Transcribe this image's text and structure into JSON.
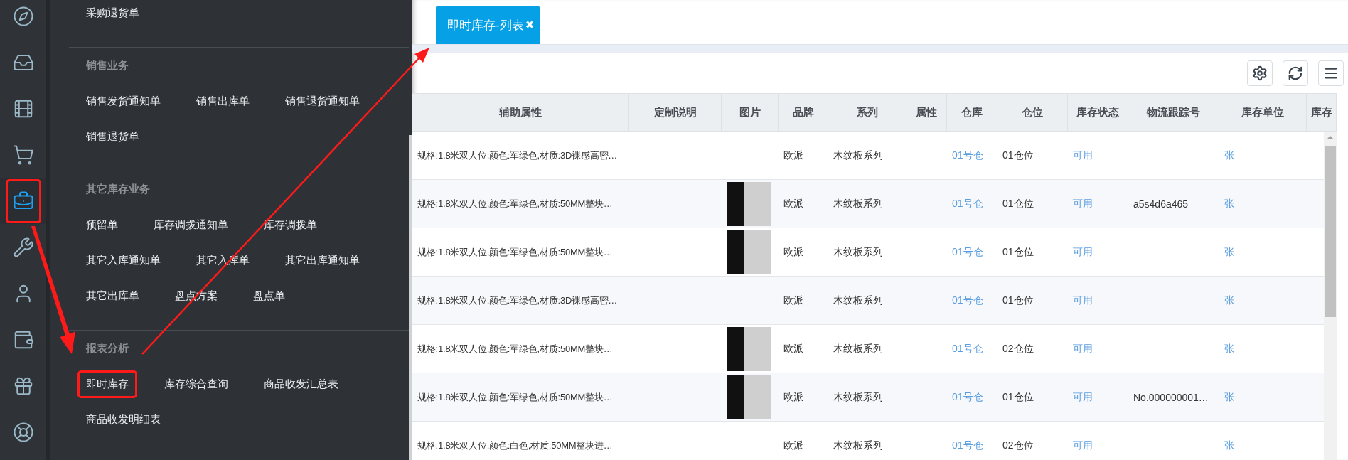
{
  "rail": [
    {
      "selected": false,
      "highlighted": false
    },
    {
      "selected": false,
      "highlighted": false
    },
    {
      "selected": false,
      "highlighted": false
    },
    {
      "selected": false,
      "highlighted": false
    },
    {
      "selected": true,
      "highlighted": true
    },
    {
      "selected": false,
      "highlighted": false
    },
    {
      "selected": false,
      "highlighted": false
    },
    {
      "selected": false,
      "highlighted": false
    },
    {
      "selected": false,
      "highlighted": false
    },
    {
      "selected": false,
      "highlighted": false
    }
  ],
  "menu": {
    "sections": [
      {
        "items": [
          {
            "label": "采购退货单",
            "highlighted": false
          }
        ]
      },
      {
        "header": "销售业务",
        "items": [
          {
            "label": "销售发货通知单",
            "highlighted": false
          },
          {
            "label": "销售出库单",
            "highlighted": false
          },
          {
            "label": "销售退货通知单",
            "highlighted": false
          },
          {
            "label": "销售退货单",
            "highlighted": false
          }
        ]
      },
      {
        "header": "其它库存业务",
        "items": [
          {
            "label": "预留单",
            "highlighted": false
          },
          {
            "label": "库存调拨通知单",
            "highlighted": false
          },
          {
            "label": "库存调拨单",
            "highlighted": false
          },
          {
            "label": "其它入库通知单",
            "highlighted": false
          },
          {
            "label": "其它入库单",
            "highlighted": false
          },
          {
            "label": "其它出库通知单",
            "highlighted": false
          },
          {
            "label": "其它出库单",
            "highlighted": false
          },
          {
            "label": "盘点方案",
            "highlighted": false
          },
          {
            "label": "盘点单",
            "highlighted": false
          }
        ]
      },
      {
        "header": "报表分析",
        "items": [
          {
            "label": "即时库存",
            "highlighted": true
          },
          {
            "label": "库存综合查询",
            "highlighted": false
          },
          {
            "label": "商品收发汇总表",
            "highlighted": false
          },
          {
            "label": "商品收发明细表",
            "highlighted": false
          }
        ]
      }
    ]
  },
  "tabs": [
    {
      "label": "即时库存-列表",
      "close": "✖",
      "selected": true
    }
  ],
  "table": {
    "columns": [
      "辅助属性",
      "定制说明",
      "图片",
      "品牌",
      "系列",
      "属性",
      "仓库",
      "仓位",
      "库存状态",
      "物流跟踪号",
      "库存单位",
      "库存"
    ],
    "rows": [
      {
        "attr": "规格:1.8米双人位,颜色:军绿色,材质:3D裸感高密…",
        "photo": false,
        "brand": "欧派",
        "series": "木纹板系列",
        "warehouse": "01号仓",
        "bin": "01仓位",
        "status": "可用",
        "tracking": "",
        "unit": "张"
      },
      {
        "attr": "规格:1.8米双人位,颜色:军绿色,材质:50MM整块…",
        "photo": true,
        "brand": "欧派",
        "series": "木纹板系列",
        "warehouse": "01号仓",
        "bin": "01仓位",
        "status": "可用",
        "tracking": "a5s4d6a465",
        "unit": "张"
      },
      {
        "attr": "规格:1.8米双人位,颜色:军绿色,材质:50MM整块…",
        "photo": true,
        "brand": "欧派",
        "series": "木纹板系列",
        "warehouse": "01号仓",
        "bin": "01仓位",
        "status": "可用",
        "tracking": "",
        "unit": "张"
      },
      {
        "attr": "规格:1.8米双人位,颜色:军绿色,材质:3D裸感高密…",
        "photo": false,
        "brand": "欧派",
        "series": "木纹板系列",
        "warehouse": "01号仓",
        "bin": "01仓位",
        "status": "可用",
        "tracking": "",
        "unit": "张"
      },
      {
        "attr": "规格:1.8米双人位,颜色:军绿色,材质:50MM整块…",
        "photo": true,
        "brand": "欧派",
        "series": "木纹板系列",
        "warehouse": "01号仓",
        "bin": "02仓位",
        "status": "可用",
        "tracking": "",
        "unit": "张"
      },
      {
        "attr": "规格:1.8米双人位,颜色:军绿色,材质:50MM整块…",
        "photo": true,
        "brand": "欧派",
        "series": "木纹板系列",
        "warehouse": "01号仓",
        "bin": "01仓位",
        "status": "可用",
        "tracking": "No.000000001…",
        "unit": "张"
      },
      {
        "attr": "规格:1.8米双人位,颜色:白色,材质:50MM整块进…",
        "photo": false,
        "brand": "欧派",
        "series": "木纹板系列",
        "warehouse": "01号仓",
        "bin": "02仓位",
        "status": "可用",
        "tracking": "",
        "unit": "张"
      }
    ]
  }
}
